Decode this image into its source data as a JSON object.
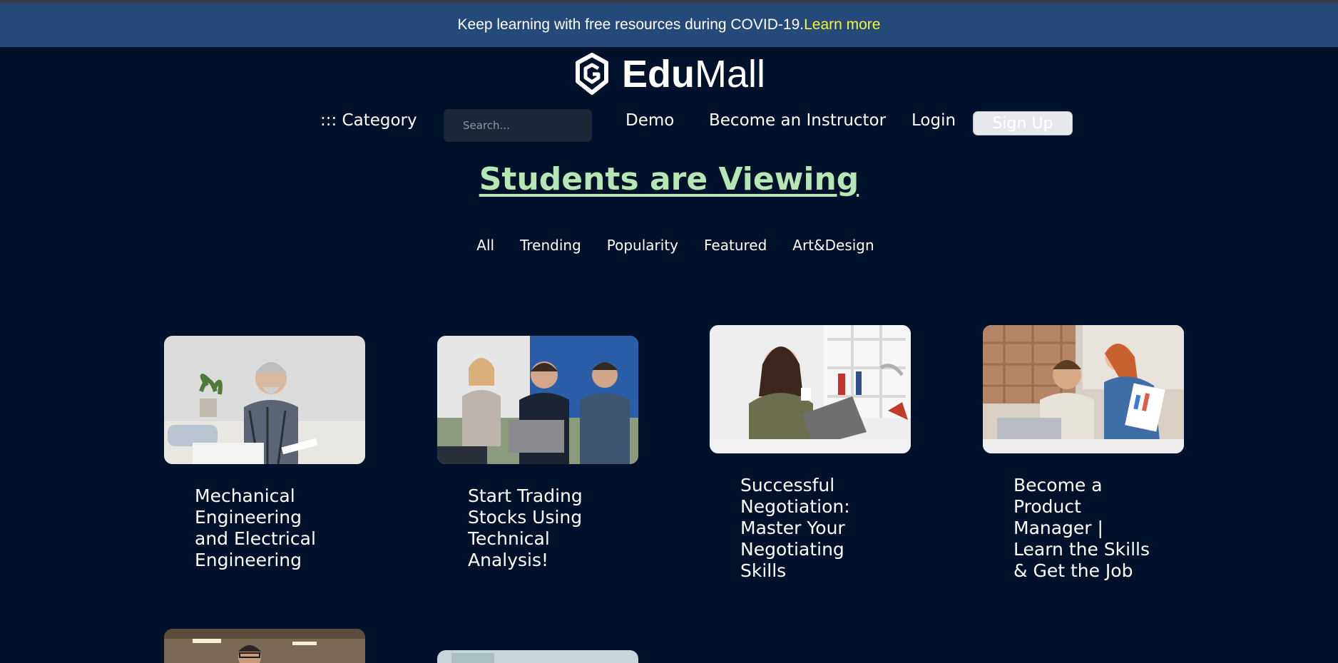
{
  "banner": {
    "message": "Keep learning with free resources during COVID-19.",
    "link_label": "Learn more"
  },
  "logo": {
    "brand_bold": "Edu",
    "brand_regular": "Mall",
    "icon": "shield-logo-icon"
  },
  "nav": {
    "category_label": "::: Category",
    "search_placeholder": "Search...",
    "demo_label": "Demo",
    "instructor_label": "Become an Instructor",
    "login_label": "Login",
    "signup_label": "Sign Up"
  },
  "section": {
    "title": "Students are Viewing"
  },
  "filters": [
    {
      "label": "All"
    },
    {
      "label": "Trending"
    },
    {
      "label": "Popularity"
    },
    {
      "label": "Featured"
    },
    {
      "label": "Art&Design"
    }
  ],
  "courses": [
    {
      "title": "Mechanical Engineering and Electrical Engineering"
    },
    {
      "title": "Start Trading Stocks Using Technical Analysis!"
    },
    {
      "title": "Successful Negotiation: Master Your Negotiating Skills"
    },
    {
      "title": "Become a Product Manager | Learn the Skills & Get the Job"
    }
  ],
  "colors": {
    "background": "#00112c",
    "banner": "#254a7a",
    "link": "#f5f53a",
    "title": "#b6e6b4"
  }
}
